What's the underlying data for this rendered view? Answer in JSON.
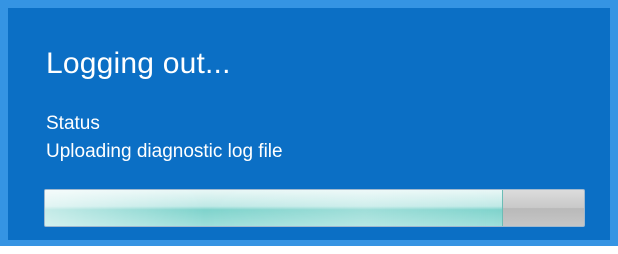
{
  "dialog": {
    "title": "Logging out...",
    "status_label": "Status",
    "status_text": "Uploading diagnostic log file",
    "progress_percent": 85
  },
  "colors": {
    "background": "#0b6fc5",
    "border": "#3594e3",
    "text": "#ffffff",
    "progress_fill": "#9fe0da",
    "progress_track": "#c8c8c8"
  }
}
